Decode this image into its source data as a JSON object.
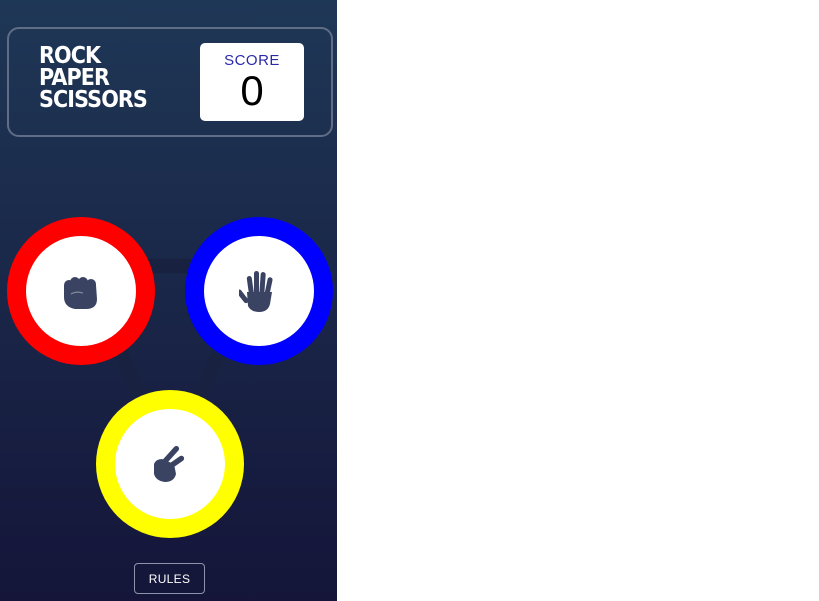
{
  "header": {
    "title_lines": [
      "ROCK",
      "PAPER",
      "SCISSORS"
    ],
    "score_label": "SCORE",
    "score_value": "0"
  },
  "choices": [
    {
      "name": "rock",
      "icon": "fist-icon",
      "ring_color": "#ff0000"
    },
    {
      "name": "paper",
      "icon": "open-hand-icon",
      "ring_color": "#0000ff"
    },
    {
      "name": "scissors",
      "icon": "peace-hand-icon",
      "ring_color": "#ffff00"
    }
  ],
  "rules_button": {
    "label": "RULES"
  },
  "colors": {
    "background_top": "#1f3756",
    "background_bottom": "#141539",
    "icon": "#3b4363"
  }
}
